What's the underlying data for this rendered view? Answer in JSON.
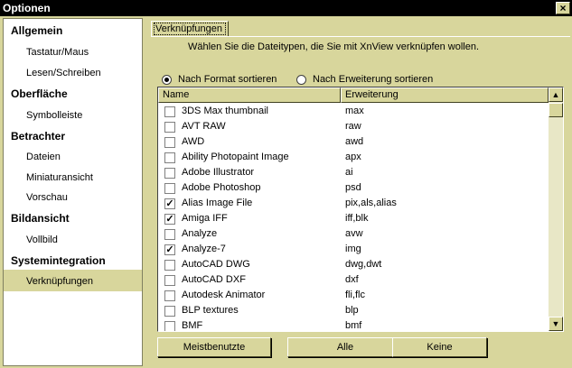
{
  "window": {
    "title": "Optionen",
    "close_glyph": "×"
  },
  "sidebar": {
    "categories": [
      {
        "label": "Allgemein",
        "items": [
          "Tastatur/Maus",
          "Lesen/Schreiben"
        ]
      },
      {
        "label": "Oberfläche",
        "items": [
          "Symbolleiste"
        ]
      },
      {
        "label": "Betrachter",
        "items": [
          "Dateien",
          "Miniaturansicht",
          "Vorschau"
        ]
      },
      {
        "label": "Bildansicht",
        "items": [
          "Vollbild"
        ]
      },
      {
        "label": "Systemintegration",
        "items": [
          "Verknüpfungen"
        ]
      }
    ],
    "selected": "Verknüpfungen"
  },
  "tab": {
    "label": "Verknüpfungen"
  },
  "instruction": "Wählen Sie die Dateitypen, die Sie mit XnView verknüpfen wollen.",
  "sort": {
    "by_format": "Nach Format sortieren",
    "by_extension": "Nach Erweiterung sortieren",
    "selected": "by_format"
  },
  "table": {
    "columns": [
      "Name",
      "Erweiterung"
    ],
    "rows": [
      {
        "name": "3DS Max thumbnail",
        "ext": "max",
        "checked": false
      },
      {
        "name": "AVT RAW",
        "ext": "raw",
        "checked": false
      },
      {
        "name": "AWD",
        "ext": "awd",
        "checked": false
      },
      {
        "name": "Ability Photopaint Image",
        "ext": "apx",
        "checked": false
      },
      {
        "name": "Adobe Illustrator",
        "ext": "ai",
        "checked": false
      },
      {
        "name": "Adobe Photoshop",
        "ext": "psd",
        "checked": false
      },
      {
        "name": "Alias Image File",
        "ext": "pix,als,alias",
        "checked": true
      },
      {
        "name": "Amiga IFF",
        "ext": "iff,blk",
        "checked": true
      },
      {
        "name": "Analyze",
        "ext": "avw",
        "checked": false
      },
      {
        "name": "Analyze-7",
        "ext": "img",
        "checked": true
      },
      {
        "name": "AutoCAD DWG",
        "ext": "dwg,dwt",
        "checked": false
      },
      {
        "name": "AutoCAD DXF",
        "ext": "dxf",
        "checked": false
      },
      {
        "name": "Autodesk Animator",
        "ext": "fli,flc",
        "checked": false
      },
      {
        "name": "BLP textures",
        "ext": "blp",
        "checked": false
      },
      {
        "name": "BMF",
        "ext": "bmf",
        "checked": false
      }
    ]
  },
  "buttons": {
    "most_used": "Meistbenutzte",
    "all": "Alle",
    "none": "Keine"
  },
  "check_glyph": "✓",
  "scroll": {
    "up_glyph": "▲",
    "down_glyph": "▼"
  }
}
